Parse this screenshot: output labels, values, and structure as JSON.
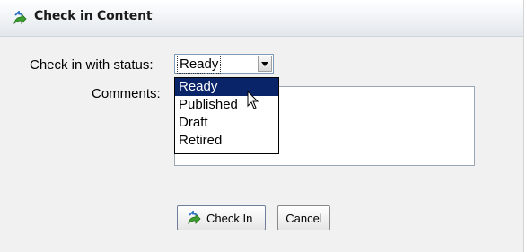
{
  "dialog": {
    "title": "Check in Content"
  },
  "form": {
    "status_label": "Check in with status:",
    "status_value": "Ready",
    "comments_label": "Comments:",
    "comments_value": ""
  },
  "status_dropdown": {
    "options": [
      "Ready",
      "Published",
      "Draft",
      "Retired"
    ],
    "highlighted": "Ready"
  },
  "buttons": {
    "check_in_label": "Check In",
    "cancel_label": "Cancel"
  },
  "icons": {
    "title_icon": "check-in-arrow-icon",
    "check_in_icon": "check-in-arrow-icon",
    "dropdown_arrow": "chevron-down-icon",
    "cursor": "mouse-pointer-icon"
  },
  "colors": {
    "selection_highlight": "#0a246a",
    "icon_green": "#3c9e2e",
    "icon_blue": "#2a6fc4"
  }
}
